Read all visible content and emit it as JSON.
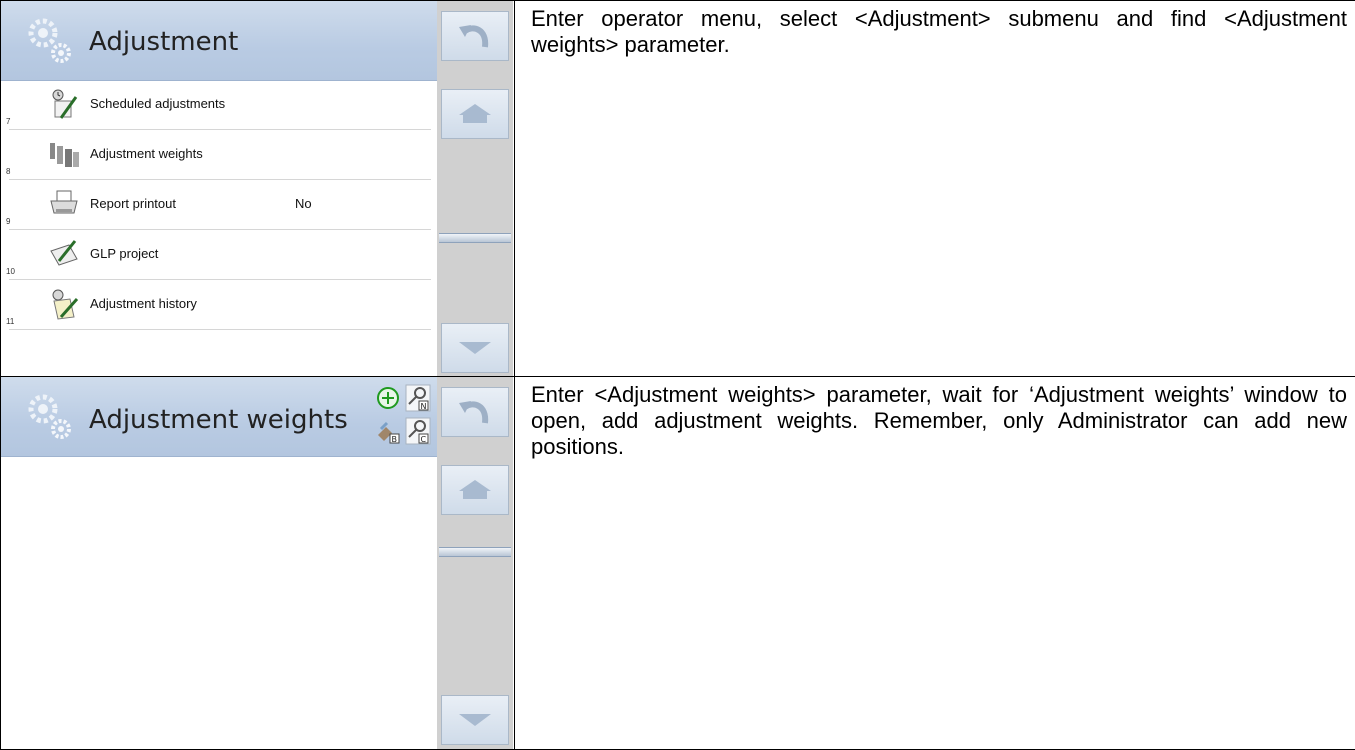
{
  "rows": [
    {
      "screen": {
        "title": "Adjustment",
        "items": [
          {
            "num": "7",
            "label": "Scheduled adjustments",
            "value": "",
            "icon": "calendar-pen-icon"
          },
          {
            "num": "8",
            "label": "Adjustment weights",
            "value": "",
            "icon": "weights-icon"
          },
          {
            "num": "9",
            "label": "Report printout",
            "value": "No",
            "icon": "printer-icon"
          },
          {
            "num": "10",
            "label": "GLP project",
            "value": "",
            "icon": "document-pen-icon"
          },
          {
            "num": "11",
            "label": "Adjustment history",
            "value": "",
            "icon": "history-icon"
          }
        ]
      },
      "instruction": "Enter operator menu, select <Adjustment> submenu and find <Adjustment weights> parameter."
    },
    {
      "screen": {
        "title": "Adjustment weights",
        "tools": [
          "add-icon",
          "filter-name-icon",
          "export-icon",
          "filter-code-icon"
        ]
      },
      "instruction": "Enter <Adjustment weights> parameter, wait for ‘Adjustment weights’ window to open, add adjustment weights. Remember, only Administrator can add new positions."
    }
  ],
  "colors": {
    "header": "#b9cbe3",
    "sidebar": "#d0d0d0",
    "button": "#dbe4ef",
    "accent": "#00a000"
  }
}
